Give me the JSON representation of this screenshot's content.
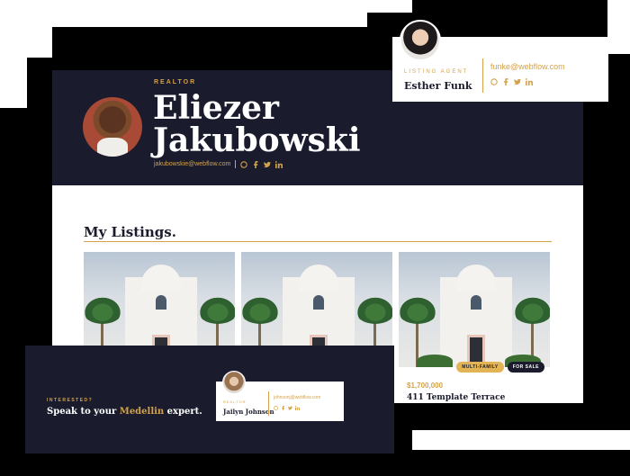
{
  "hero": {
    "eyebrow": "REALTOR",
    "name": "Eliezer Jakubowski",
    "email": "jakubowskie@webflow.com"
  },
  "listings": {
    "title": "My Listings.",
    "cards": [
      {},
      {},
      {
        "tag_type": "MULTI-FAMILY",
        "tag_status": "FOR SALE",
        "price": "$1,700,000",
        "address": "411 Template Terrace"
      }
    ]
  },
  "agent_card": {
    "eyebrow": "LISTING AGENT",
    "name": "Esther Funk",
    "email": "funke@webflow.com"
  },
  "cta": {
    "eyebrow": "INTERESTED?",
    "text_before": "Speak to your ",
    "highlight": "Medellin",
    "text_after": " expert.",
    "agent": {
      "eyebrow": "REALTOR",
      "name": "Jailyn Johnson",
      "email": "johnsonj@webflow.com"
    }
  },
  "icons": [
    "whatsapp-icon",
    "facebook-icon",
    "twitter-icon",
    "linkedin-icon"
  ],
  "colors": {
    "navy": "#1a1c2d",
    "gold": "#d4a24a",
    "white": "#ffffff"
  }
}
